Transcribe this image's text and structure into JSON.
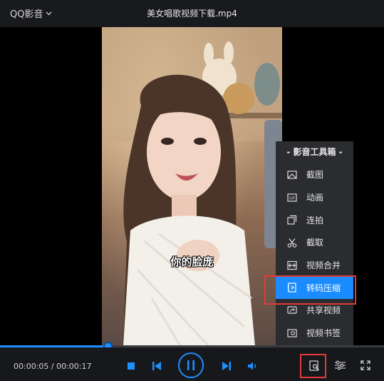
{
  "app": {
    "brand": "QQ影音",
    "window_title": "美女唱歌视频下载.mp4"
  },
  "video": {
    "subtitle": "你的脸庞",
    "time_display": "00:00:05 / 00:00:17",
    "progress": 0.28
  },
  "toolbox": {
    "title": "- 影音工具箱 -",
    "items": [
      {
        "label": "截图",
        "icon": "screenshot-icon"
      },
      {
        "label": "动画",
        "icon": "gif-icon"
      },
      {
        "label": "连拍",
        "icon": "burst-icon"
      },
      {
        "label": "截取",
        "icon": "scissors-icon"
      },
      {
        "label": "视频合并",
        "icon": "merge-icon"
      },
      {
        "label": "转码压缩",
        "icon": "transcode-icon",
        "active": true
      },
      {
        "label": "共享视频",
        "icon": "share-icon"
      },
      {
        "label": "视频书签",
        "icon": "bookmark-icon"
      }
    ]
  },
  "colors": {
    "accent": "#1a8cff",
    "highlight": "#e53939",
    "panel": "#2b2c30"
  }
}
